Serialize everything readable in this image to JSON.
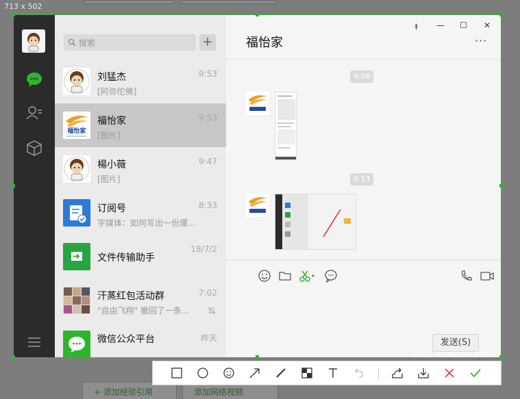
{
  "capture": {
    "size_label": "713 x 502"
  },
  "background": {
    "bottom_buttons": [
      "+ 添加经验引用",
      "添加网络视频"
    ]
  },
  "sidebar": {
    "icons": [
      "chat-icon",
      "contacts-icon",
      "favorites-cube-icon",
      "menu-icon"
    ]
  },
  "chat_list": {
    "search_placeholder": "搜索",
    "add_label": "+",
    "items": [
      {
        "name": "刘猛杰",
        "time": "9:53",
        "preview": "[阿弥佗佛]",
        "avatar": "cartoon"
      },
      {
        "name": "福怡家",
        "time": "9:53",
        "preview": "[图片]",
        "avatar": "logo"
      },
      {
        "name": "楊小薇",
        "time": "9:47",
        "preview": "[图片]",
        "avatar": "cartoon"
      },
      {
        "name": "订阅号",
        "time": "8:33",
        "preview": "字媒体：如何写出一份爆...",
        "avatar": "subscription"
      },
      {
        "name": "文件传输助手",
        "time": "18/7/2",
        "preview": "",
        "avatar": "file-transfer"
      },
      {
        "name": "汗蒸红包活动群",
        "time": "7:02",
        "preview": "\"自由飞翔\" 撤回了一条...",
        "avatar": "group"
      },
      {
        "name": "微信公众平台",
        "time": "昨天",
        "preview": "",
        "avatar": "wechat-platform"
      }
    ],
    "logo_text": "福怡家"
  },
  "chat": {
    "title": "福怡家",
    "more_label": "···",
    "window_controls": [
      "⯒",
      "—",
      "☐",
      "✕"
    ],
    "timestamps": [
      "9:06",
      "9:53"
    ],
    "send_label": "发送(S)"
  },
  "colors": {
    "accent": "#2db52d",
    "sidebar": "#2b2b2b",
    "list_bg": "#eceaea",
    "active_item": "#c9c7c7"
  },
  "watermark": "Baidu 经验"
}
